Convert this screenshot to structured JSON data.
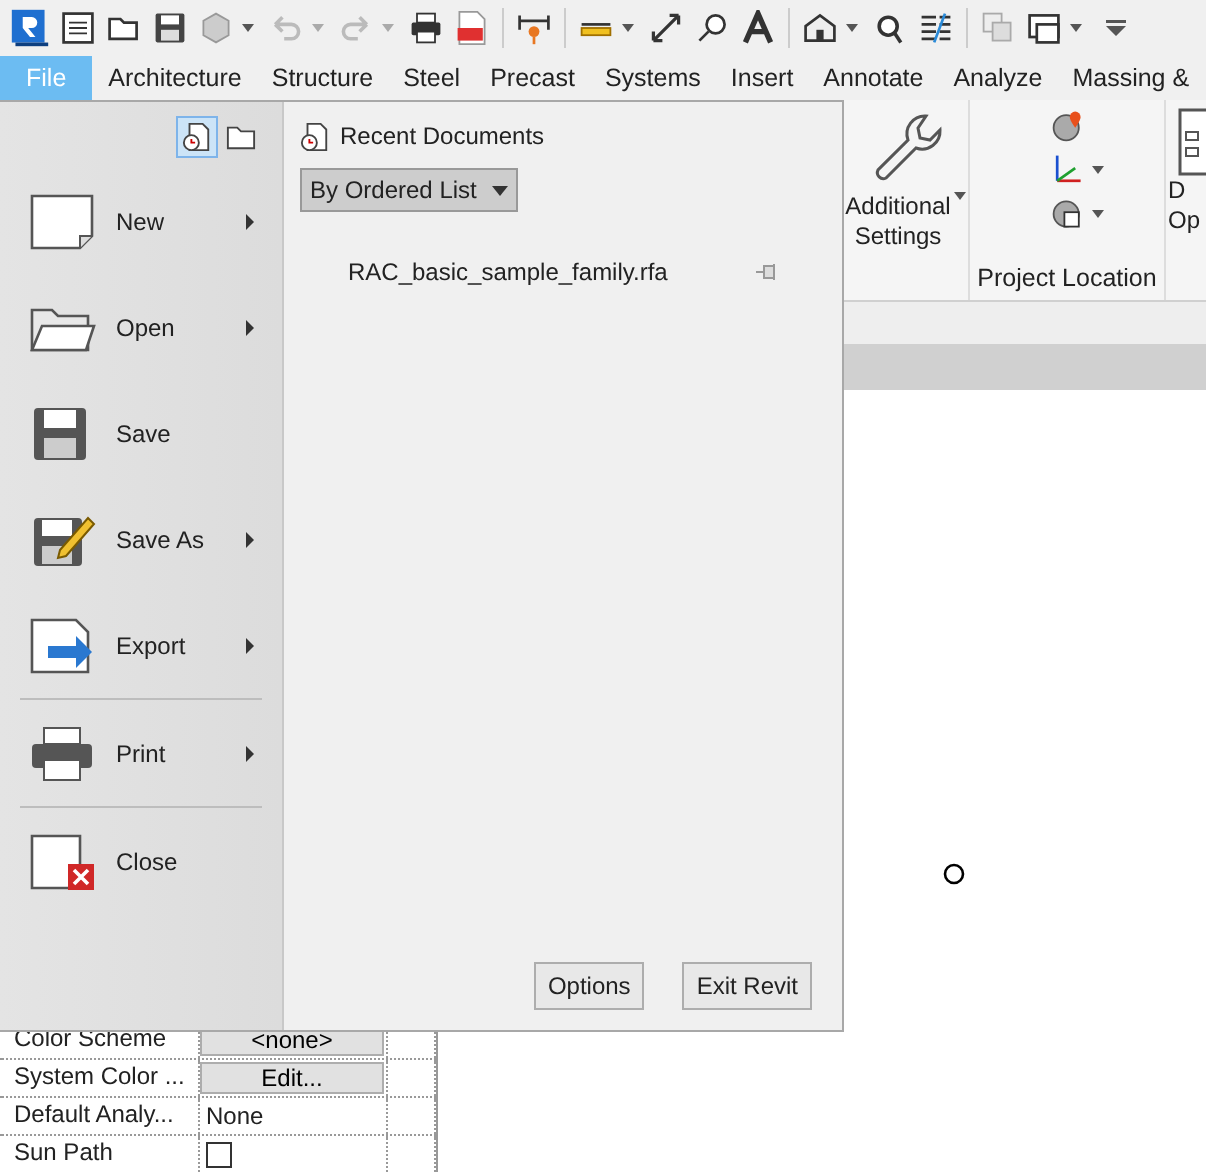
{
  "ribbon_tabs": [
    {
      "label": "File",
      "selected": true
    },
    {
      "label": "Architecture",
      "selected": false
    },
    {
      "label": "Structure",
      "selected": false
    },
    {
      "label": "Steel",
      "selected": false
    },
    {
      "label": "Precast",
      "selected": false
    },
    {
      "label": "Systems",
      "selected": false
    },
    {
      "label": "Insert",
      "selected": false
    },
    {
      "label": "Annotate",
      "selected": false
    },
    {
      "label": "Analyze",
      "selected": false
    },
    {
      "label": "Massing &",
      "selected": false
    }
  ],
  "ribbon": {
    "settings_button": [
      "Additional",
      "Settings"
    ],
    "project_location": "Project Location",
    "cut_button": [
      "D",
      "Op"
    ]
  },
  "properties": [
    {
      "name": "Color Scheme",
      "kind": "button",
      "value": "<none>"
    },
    {
      "name": "System Color ...",
      "kind": "button",
      "value": "Edit..."
    },
    {
      "name": "Default Analy...",
      "kind": "text",
      "value": "None"
    },
    {
      "name": "Sun Path",
      "kind": "checkbox",
      "checked": false
    }
  ],
  "app_menu": {
    "view_toggles": [
      {
        "kind": "recent",
        "selected": true
      },
      {
        "kind": "open",
        "selected": false
      }
    ],
    "commands": [
      {
        "kind": "new",
        "label": "New",
        "submenu": true,
        "divider_after": false
      },
      {
        "kind": "open",
        "label": "Open",
        "submenu": true,
        "divider_after": false
      },
      {
        "kind": "save",
        "label": "Save",
        "submenu": false,
        "divider_after": false
      },
      {
        "kind": "saveas",
        "label": "Save As",
        "submenu": true,
        "divider_after": false
      },
      {
        "kind": "export",
        "label": "Export",
        "submenu": true,
        "divider_after": true
      },
      {
        "kind": "print",
        "label": "Print",
        "submenu": true,
        "divider_after": true
      },
      {
        "kind": "close",
        "label": "Close",
        "submenu": false,
        "divider_after": false
      }
    ],
    "recent": {
      "title": "Recent Documents",
      "sort": "By Ordered List",
      "files": [
        {
          "name": "RAC_basic_sample_family.rfa",
          "pinned": false
        }
      ]
    },
    "buttons": [
      "Options",
      "Exit Revit"
    ]
  }
}
